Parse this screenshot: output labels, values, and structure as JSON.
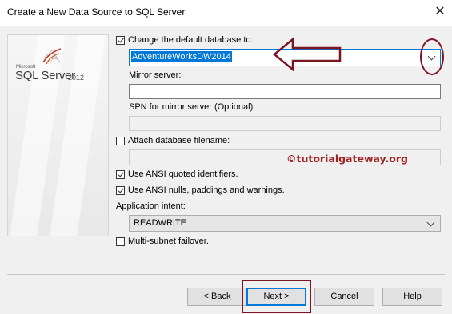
{
  "window": {
    "title": "Create a New Data Source to SQL Server",
    "close_symbol": "✕"
  },
  "branding": {
    "microsoft": "Microsoft",
    "product": "SQL Server",
    "version": "2012"
  },
  "form": {
    "change_db": {
      "label": "Change the default database to:",
      "checked": true,
      "value": "AdventureWorksDW2014"
    },
    "mirror_server": {
      "label": "Mirror server:",
      "value": ""
    },
    "spn": {
      "label": "SPN for mirror server (Optional):",
      "value": ""
    },
    "attach_db": {
      "label": "Attach database filename:",
      "checked": false,
      "value": ""
    },
    "ansi_quoted": {
      "label": "Use ANSI quoted identifiers.",
      "checked": true
    },
    "ansi_nulls": {
      "label": "Use ANSI nulls, paddings and warnings.",
      "checked": true
    },
    "app_intent": {
      "label": "Application intent:",
      "value": "READWRITE"
    },
    "multi_subnet": {
      "label": "Multi-subnet failover.",
      "checked": false
    }
  },
  "watermark": "©tutorialgateway.org",
  "buttons": {
    "back": "< Back",
    "next": "Next >",
    "cancel": "Cancel",
    "help": "Help"
  },
  "colors": {
    "accent": "#0078d7",
    "annotation": "#7b1521",
    "watermark": "#a02020"
  }
}
